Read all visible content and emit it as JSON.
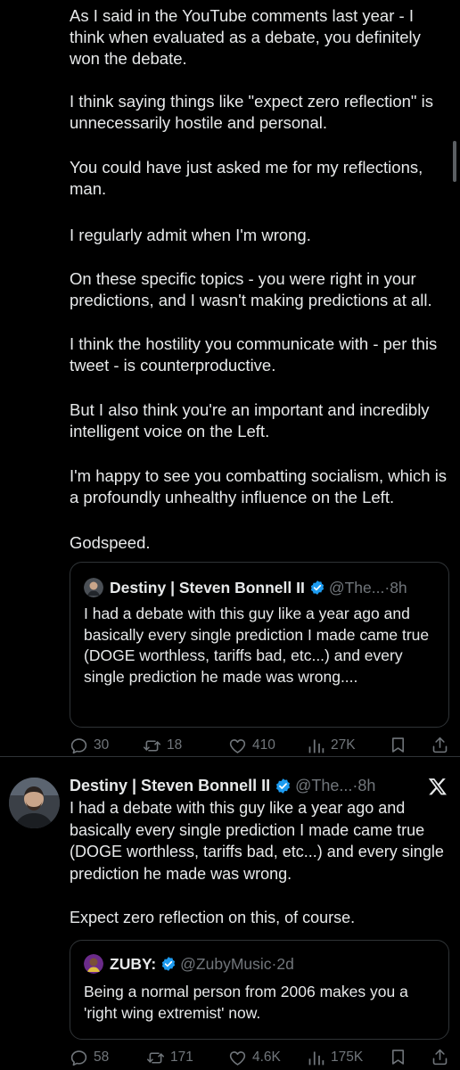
{
  "tweet1": {
    "paragraphs": [
      "As I said in the YouTube comments last year - I think when evaluated as a debate, you definitely won the debate.",
      "I think saying things like \"expect zero reflection\" is unnecessarily hostile and personal.",
      "You could have just asked me for my reflections, man.",
      "I regularly admit when I'm wrong.",
      "On these specific topics - you were right in your predictions, and I wasn't making predictions at all.",
      "I think the hostility you communicate with - per this tweet - is counterproductive.",
      "But I also think you're an important and incredibly intelligent voice on the Left.",
      "I'm happy to see you combatting socialism, which is a profoundly unhealthy influence on the Left.",
      "Godspeed."
    ],
    "quote": {
      "name": "Destiny | Steven Bonnell II",
      "handle": "@The...",
      "separator": " · ",
      "time": "8h",
      "text": "I had a debate with this guy like a year ago and basically every single prediction I made came true (DOGE worthless, tariffs bad, etc...) and every single prediction he made was wrong...."
    },
    "actions": {
      "replies": "30",
      "reposts": "18",
      "likes": "410",
      "views": "27K"
    }
  },
  "tweet2": {
    "name": "Destiny | Steven Bonnell II",
    "handle": "@The...",
    "separator": " · ",
    "time": "8h",
    "paragraphs": [
      "I had a debate with this guy like a year ago and basically every single prediction I made came true (DOGE worthless, tariffs bad, etc...) and every single prediction he made was wrong.",
      "Expect zero reflection on this, of course."
    ],
    "quote": {
      "name": "ZUBY:",
      "handle": "@ZubyMusic",
      "separator": " · ",
      "time": "2d",
      "text": "Being a normal person from 2006 makes you a 'right wing extremist' now."
    },
    "actions": {
      "replies": "58",
      "reposts": "171",
      "likes": "4.6K",
      "views": "175K"
    }
  },
  "icons": {
    "reply": "reply-icon",
    "repost": "repost-icon",
    "like": "heart-icon",
    "views": "views-icon",
    "bookmark": "bookmark-icon",
    "share": "share-icon",
    "verified": "verified-badge-icon",
    "x_logo": "x-logo-icon"
  },
  "colors": {
    "background": "#000000",
    "text": "#e7e9ea",
    "secondary": "#71767b",
    "border": "#2f3336",
    "verified": "#1d9bf0"
  }
}
